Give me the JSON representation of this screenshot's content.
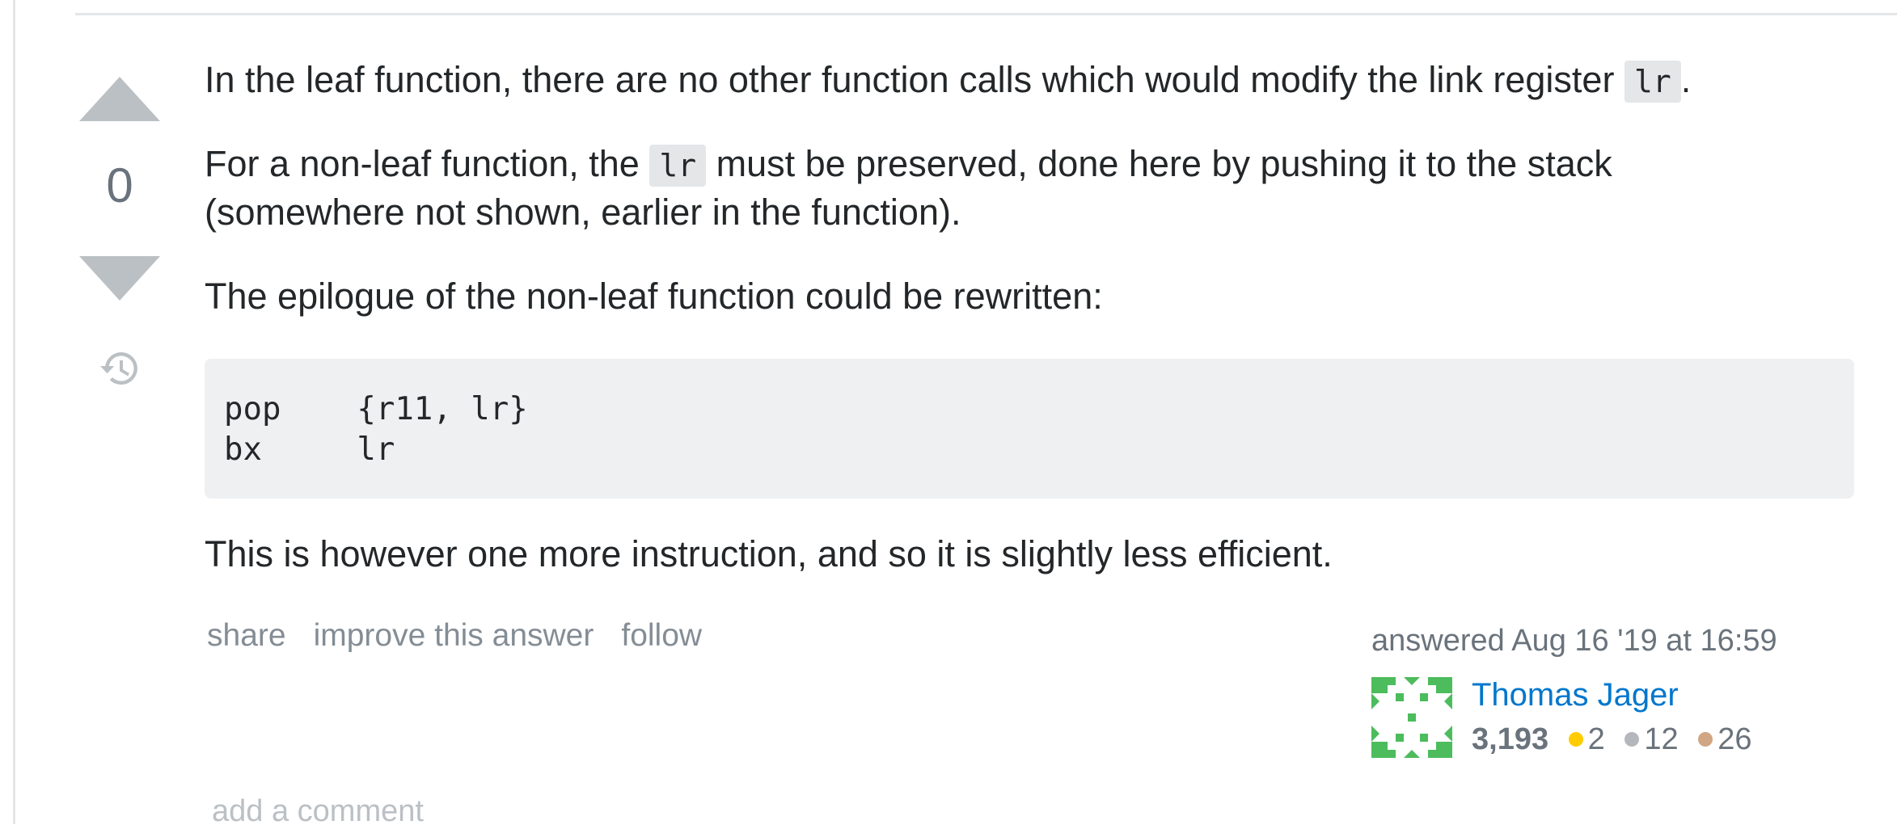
{
  "vote": {
    "count": "0"
  },
  "post": {
    "p1_text": "In the leaf function, there are no other function calls which would modify the link register ",
    "p1_code": "lr",
    "p1_end": ".",
    "p2_start": "For a non-leaf function, the ",
    "p2_code": "lr",
    "p2_end": " must be preserved, done here by pushing it to the stack (somewhere not shown, earlier in the function).",
    "p3": "The epilogue of the non-leaf function could be rewritten:",
    "code_block": "pop    {r11, lr}\nbx     lr",
    "p4": "This is however one more instruction, and so it is slightly less efficient."
  },
  "menu": {
    "share": "share",
    "improve": "improve this answer",
    "follow": "follow"
  },
  "signature": {
    "action_time": "answered Aug 16 '19 at 16:59",
    "user_name": "Thomas Jager",
    "reputation": "3,193",
    "gold": "2",
    "silver": "12",
    "bronze": "26"
  },
  "colors": {
    "gold": "#ffcc01",
    "silver": "#b4b8bc",
    "bronze": "#d1a684",
    "link": "#0077cc",
    "identicon": "#4cbc5c"
  },
  "add_comment": "add a comment"
}
